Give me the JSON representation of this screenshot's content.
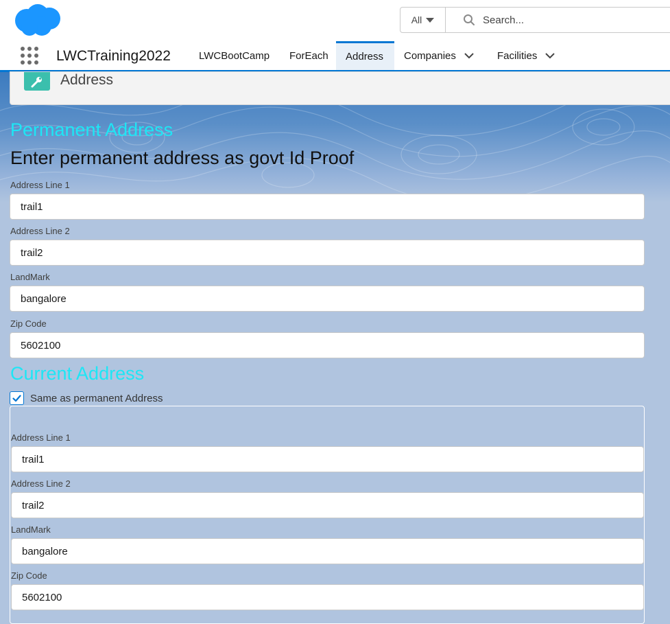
{
  "header": {
    "search_scope": "All",
    "search_placeholder": "Search..."
  },
  "nav": {
    "app_name": "LWCTraining2022",
    "items": [
      {
        "label": "LWCBootCamp"
      },
      {
        "label": "ForEach"
      },
      {
        "label": "Address"
      },
      {
        "label": "Companies"
      },
      {
        "label": "Facilities"
      }
    ],
    "active_item": "Address"
  },
  "page": {
    "title": "Address"
  },
  "permanent": {
    "heading": "Permanent Address",
    "subtitle": "Enter permanent address as govt Id Proof",
    "fields": [
      {
        "label": "Address Line 1",
        "value": "trail1"
      },
      {
        "label": "Address Line 2",
        "value": "trail2"
      },
      {
        "label": "LandMark",
        "value": "bangalore"
      },
      {
        "label": "Zip Code",
        "value": "5602100"
      }
    ]
  },
  "current": {
    "heading": "Current Address",
    "same_as_label": "Same as permanent Address",
    "same_as_checked": true,
    "fields": [
      {
        "label": "Address Line 1",
        "value": "trail1"
      },
      {
        "label": "Address Line 2",
        "value": "trail2"
      },
      {
        "label": "LandMark",
        "value": "bangalore"
      },
      {
        "label": "Zip Code",
        "value": "5602100"
      }
    ]
  },
  "colors": {
    "brand_blue": "#0176d3",
    "heading_cyan": "#1ee6f5",
    "object_icon": "#3bbfad",
    "page_background": "#b0c4df"
  }
}
